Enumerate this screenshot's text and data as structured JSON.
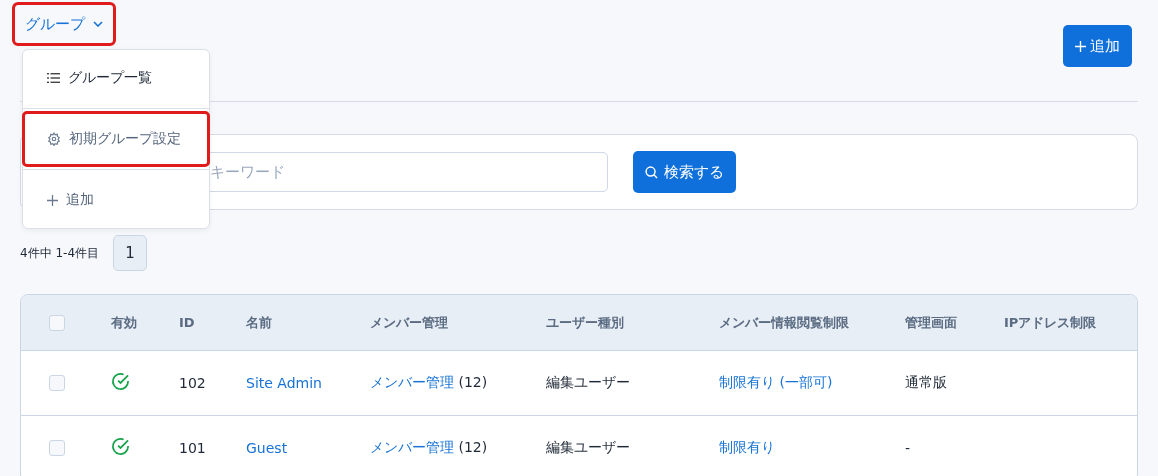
{
  "group_menu": {
    "label": "グループ",
    "highlighted": true,
    "expanded": true,
    "items": [
      {
        "kind": "list",
        "label": "グループ一覧",
        "highlighted": false
      },
      {
        "kind": "settings",
        "label": "初期グループ設定",
        "highlighted": true
      },
      {
        "kind": "add",
        "label": "追加",
        "highlighted": false
      }
    ]
  },
  "add_button": {
    "label": "追加"
  },
  "search": {
    "placeholder": "キーワード",
    "button": "検索する"
  },
  "pagination": {
    "summary": "4件中 1-4件目",
    "pages": [
      {
        "label": "1",
        "selected": true
      }
    ]
  },
  "table": {
    "all_checked": false,
    "columns": [
      "有効",
      "ID",
      "名前",
      "メンバー管理",
      "ユーザー種別",
      "メンバー情報閲覧制限",
      "管理画面",
      "IPアドレス制限"
    ],
    "rows": [
      {
        "checked": false,
        "enabled": true,
        "id": "102",
        "name": "Site Admin",
        "member_link": "メンバー管理",
        "member_count": "(12)",
        "user_type": "編集ユーザー",
        "restriction": "制限有り (一部可)",
        "admin_screen": "通常版"
      },
      {
        "checked": false,
        "enabled": true,
        "id": "101",
        "name": "Guest",
        "member_link": "メンバー管理",
        "member_count": "(12)",
        "user_type": "編集ユーザー",
        "restriction": "制限有り",
        "admin_screen": "-"
      }
    ]
  }
}
